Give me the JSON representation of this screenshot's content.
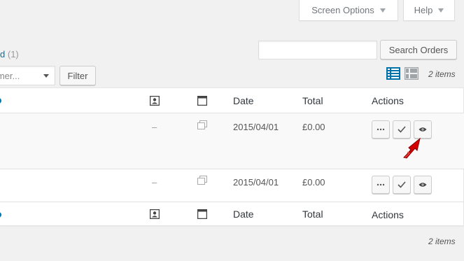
{
  "screen_meta": {
    "screen_options_label": "Screen Options",
    "help_label": "Help"
  },
  "subsubsub": {
    "link_fragment": "d",
    "count": "(1)"
  },
  "search": {
    "input_value": "",
    "button_label": "Search Orders"
  },
  "filters": {
    "customer_select_value": "tomer...",
    "filter_button_label": "Filter"
  },
  "items_count_top": "2 items",
  "items_count_bottom": "2 items",
  "table": {
    "headers": {
      "date": "Date",
      "total": "Total",
      "actions": "Actions"
    },
    "rows": [
      {
        "billing": "–",
        "date": "2015/04/01",
        "total": "£0.00"
      },
      {
        "billing": "–",
        "date": "2015/04/01",
        "total": "£0.00"
      }
    ]
  },
  "colors": {
    "link": "#0073aa",
    "arrow_annotation": "#e00000",
    "view_active": "#0073aa"
  },
  "icons": {
    "customer_column": "contact-card-icon",
    "shipping_column": "window-icon",
    "row_note": "note-icon",
    "action_more": "ellipsis-icon",
    "action_complete": "checkmark-icon",
    "action_view": "eye-icon",
    "annotation": "red-arrow-icon"
  }
}
